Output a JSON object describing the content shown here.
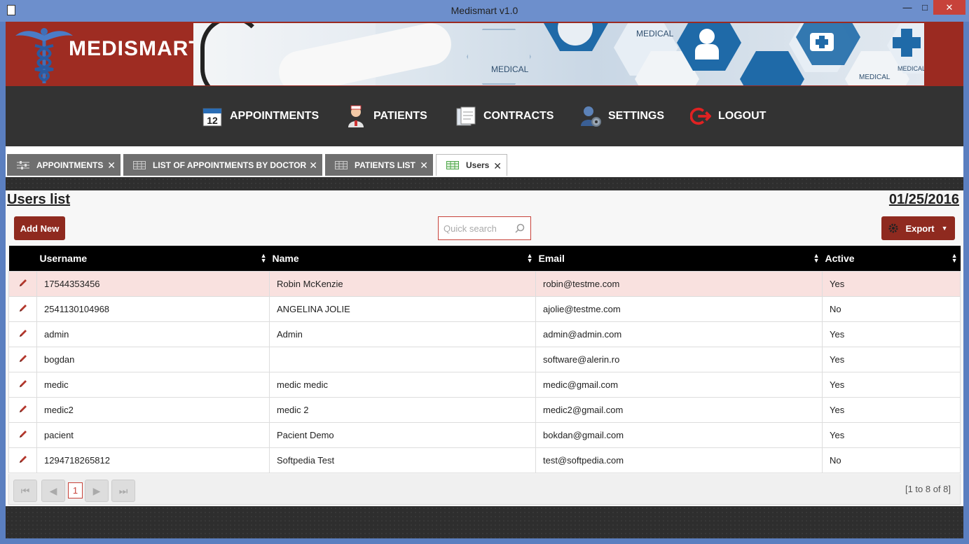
{
  "window": {
    "title": "Medismart v1.0",
    "minimize": "—",
    "maximize": "□",
    "close": "✕"
  },
  "brand": {
    "name": "MEDISMART",
    "banner_labels": [
      "MEDICAL",
      "MEDICAL",
      "MEDICAL",
      "MEDICAL"
    ],
    "color": "#9b2a21"
  },
  "nav": {
    "items": [
      {
        "label": "APPOINTMENTS",
        "icon": "calendar-icon"
      },
      {
        "label": "PATIENTS",
        "icon": "nurse-icon"
      },
      {
        "label": "CONTRACTS",
        "icon": "contracts-icon"
      },
      {
        "label": "SETTINGS",
        "icon": "user-gear-icon"
      },
      {
        "label": "LOGOUT",
        "icon": "logout-icon"
      }
    ]
  },
  "tabs": [
    {
      "label": "APPOINTMENTS",
      "icon": "sliders-icon",
      "active": false
    },
    {
      "label": "LIST OF APPOINTMENTS BY DOCTOR",
      "icon": "grid-icon",
      "active": false
    },
    {
      "label": "PATIENTS LIST",
      "icon": "grid-icon",
      "active": false
    },
    {
      "label": "Users",
      "icon": "grid-icon",
      "active": true
    }
  ],
  "page": {
    "title": "Users list",
    "date": "01/25/2016",
    "add_new": "Add New",
    "export": "Export",
    "search_placeholder": "Quick search"
  },
  "table": {
    "columns": [
      "Username",
      "Name",
      "Email",
      "Active"
    ],
    "rows": [
      {
        "username": "17544353456",
        "name": "Robin McKenzie",
        "email": "robin@testme.com",
        "active": "Yes"
      },
      {
        "username": "2541130104968",
        "name": "ANGELINA JOLIE",
        "email": "ajolie@testme.com",
        "active": "No"
      },
      {
        "username": "admin",
        "name": "Admin",
        "email": "admin@admin.com",
        "active": "Yes"
      },
      {
        "username": "bogdan",
        "name": "",
        "email": "software@alerin.ro",
        "active": "Yes"
      },
      {
        "username": "medic",
        "name": "medic medic",
        "email": "medic@gmail.com",
        "active": "Yes"
      },
      {
        "username": "medic2",
        "name": "medic 2",
        "email": "medic2@gmail.com",
        "active": "Yes"
      },
      {
        "username": "pacient",
        "name": "Pacient Demo",
        "email": "bokdan@gmail.com",
        "active": "Yes"
      },
      {
        "username": "1294718265812",
        "name": "Softpedia Test",
        "email": "test@softpedia.com",
        "active": "No"
      }
    ]
  },
  "pager": {
    "current_page": "1",
    "info": "[1 to 8 of 8]"
  },
  "colors": {
    "accent": "#8f2a1f",
    "nav_bg": "#333333",
    "selected_row": "#f9e1df"
  }
}
